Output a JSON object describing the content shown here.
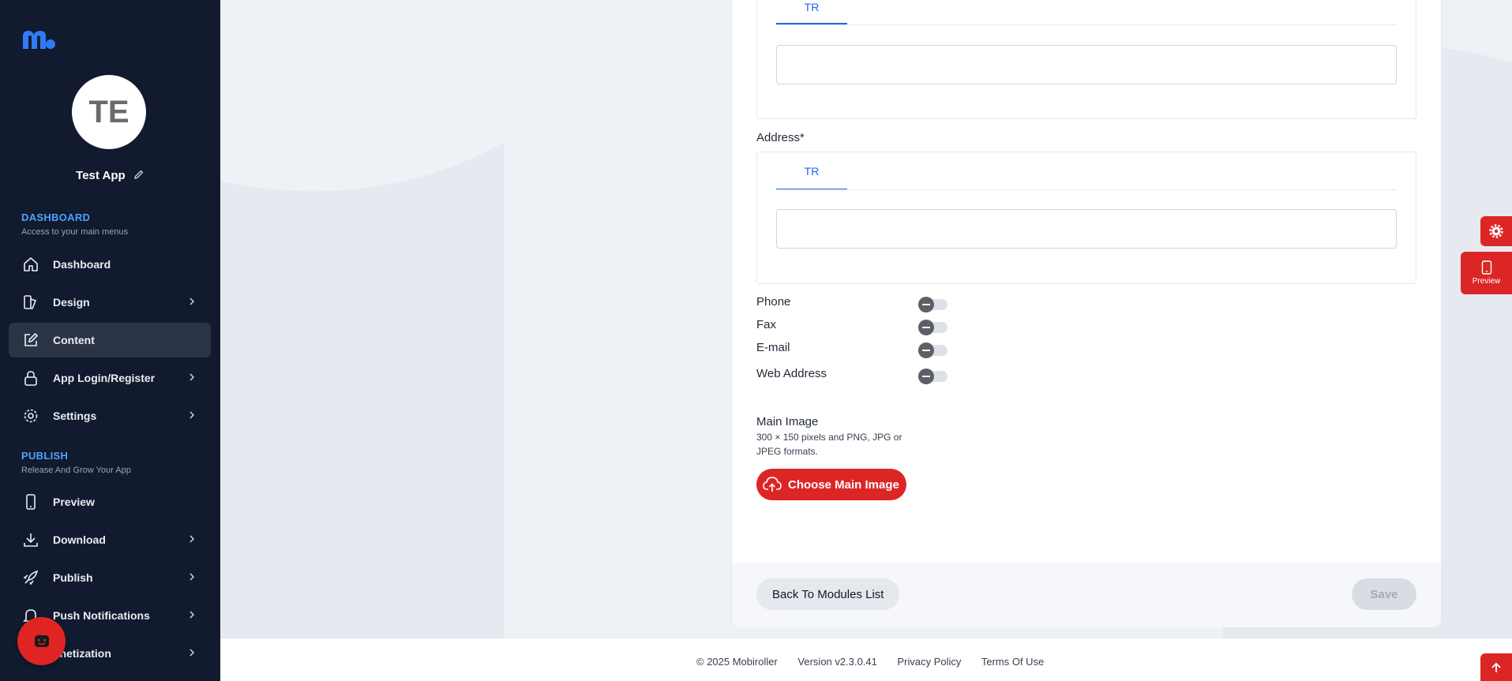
{
  "sidebar": {
    "avatar_initials": "TE",
    "app_name": "Test App",
    "dashboard_section": {
      "title": "DASHBOARD",
      "subtitle": "Access to your main menus"
    },
    "publish_section": {
      "title": "PUBLISH",
      "subtitle": "Release And Grow Your App"
    },
    "items": [
      {
        "label": "Dashboard",
        "icon": "home-icon"
      },
      {
        "label": "Design",
        "icon": "palette-icon"
      },
      {
        "label": "Content",
        "icon": "edit-icon",
        "active": true
      },
      {
        "label": "App Login/Register",
        "icon": "lock-icon"
      },
      {
        "label": "Settings",
        "icon": "gear-icon"
      },
      {
        "label": "Preview",
        "icon": "phone-icon"
      },
      {
        "label": "Download",
        "icon": "download-icon"
      },
      {
        "label": "Publish",
        "icon": "rocket-icon"
      },
      {
        "label": "Push Notifications",
        "icon": "bell-icon"
      },
      {
        "label": "onetization",
        "icon": "money-icon"
      }
    ]
  },
  "form": {
    "top_lang_tab": "TR",
    "address_label": "Address*",
    "address_lang_tab": "TR",
    "toggles": [
      {
        "label": "Phone",
        "on": false
      },
      {
        "label": "Fax",
        "on": false
      },
      {
        "label": "E-mail",
        "on": false
      },
      {
        "label": "Web Address",
        "on": false
      }
    ],
    "main_image": {
      "title": "Main Image",
      "hint": "300 × 150 pixels and PNG, JPG or JPEG formats.",
      "button_label": "Choose Main Image"
    },
    "back_button": "Back To Modules List",
    "save_button": "Save"
  },
  "footer": {
    "copyright": "© 2025 Mobiroller",
    "version": "Version v2.3.0.41",
    "privacy": "Privacy Policy",
    "terms": "Terms Of Use"
  },
  "floating": {
    "preview_label": "Preview"
  },
  "colors": {
    "sidebar_bg": "#111a2e",
    "accent_blue": "#2563eb",
    "accent_red": "#dc2626"
  }
}
